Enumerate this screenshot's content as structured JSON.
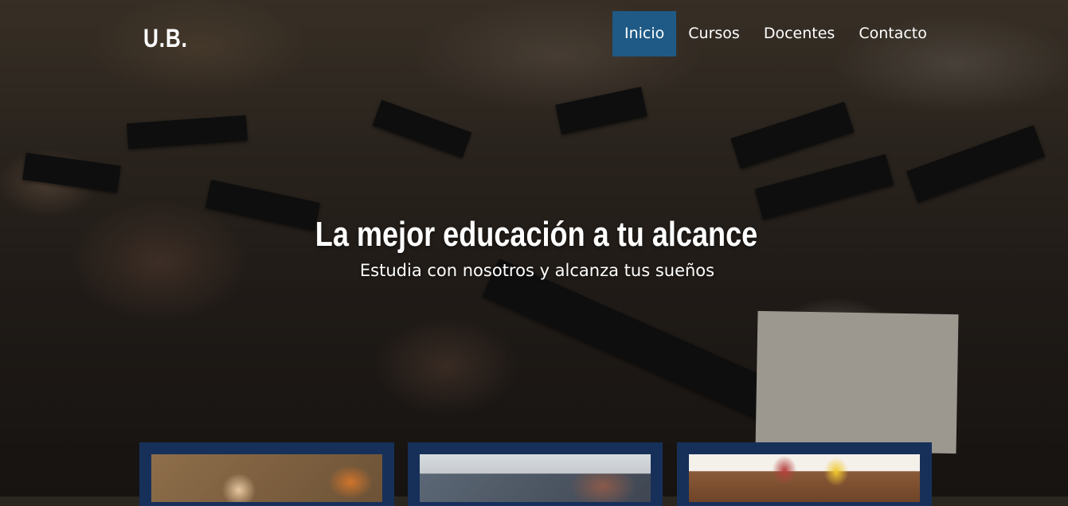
{
  "header": {
    "logo": "U.B.",
    "nav": [
      {
        "label": "Inicio",
        "active": true
      },
      {
        "label": "Cursos",
        "active": false
      },
      {
        "label": "Docentes",
        "active": false
      },
      {
        "label": "Contacto",
        "active": false
      }
    ]
  },
  "hero": {
    "title": "La mejor educación a tu alcance",
    "subtitle": "Estudia con nosotros y alcanza tus sueños",
    "background": "graduation-ceremony-photo"
  },
  "cards": [
    {
      "image": "students-card-image"
    },
    {
      "image": "laptop-card-image"
    },
    {
      "image": "study-table-card-image"
    }
  ],
  "colors": {
    "nav_active": "#1f5a86",
    "card_frame": "#17305a",
    "text": "#ffffff"
  }
}
